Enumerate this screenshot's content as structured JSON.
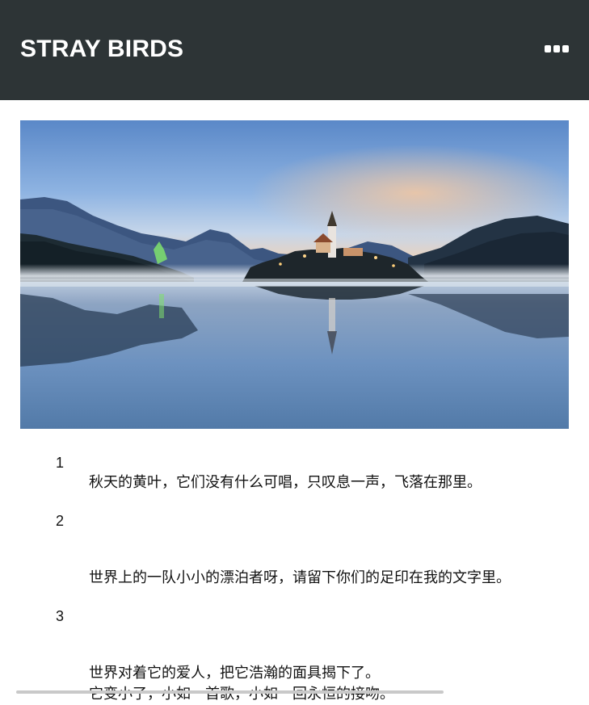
{
  "header": {
    "title": "STRAY BIRDS",
    "menu_icon": "more-horizontal-icon"
  },
  "hero": {
    "description_icon": "lake-island-church-photo"
  },
  "poems": [
    {
      "number": "1",
      "lines": [
        "秋天的黄叶，它们没有什么可唱，只叹息一声，飞落在那里。"
      ]
    },
    {
      "number": "2",
      "lines": [
        "世界上的一队小小的漂泊者呀，请留下你们的足印在我的文字里。"
      ]
    },
    {
      "number": "3",
      "lines": [
        "世界对着它的爱人，把它浩瀚的面具揭下了。",
        "它变小了，小如一首歌，小如一回永恒的接吻。"
      ]
    }
  ],
  "colors": {
    "header_bg": "#2d3436",
    "text": "#111111",
    "sky_top": "#5b8fd1",
    "sky_horizon": "#f4c9a4"
  }
}
